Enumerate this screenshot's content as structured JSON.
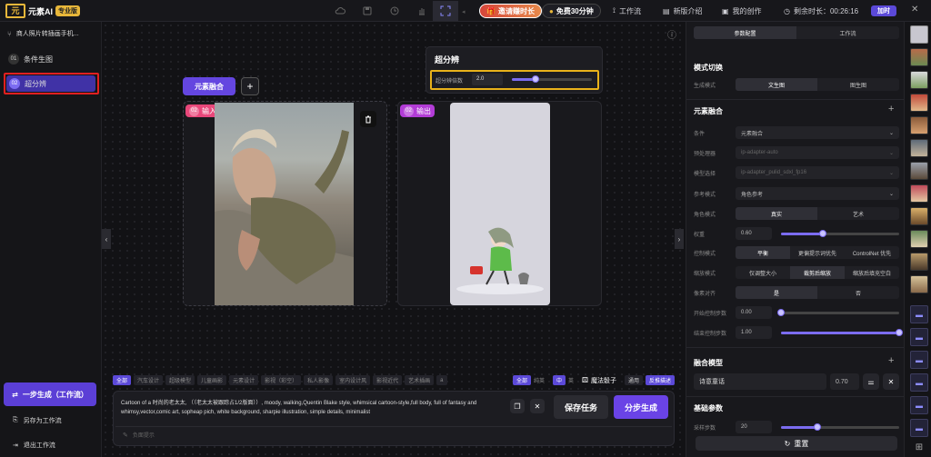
{
  "topbar": {
    "logo_text": "元素AI",
    "pro_badge": "专业版",
    "invite_label": "邀请赚时长",
    "free_label": "免费30分钟",
    "workflow_label": "工作流",
    "new_intro_label": "新版介绍",
    "my_works_label": "我的创作",
    "time_left_label": "剩余时长：00:26:16",
    "renew_label": "加时"
  },
  "left": {
    "project_title": "商人照片转插画手机...",
    "steps": [
      {
        "num": "01",
        "label": "条件生图"
      },
      {
        "num": "02",
        "label": "超分辨"
      }
    ],
    "one_step_label": "一步生成（工作流）",
    "save_workflow_label": "另存为工作流",
    "exit_workflow_label": "退出工作流"
  },
  "canvas": {
    "node_title": "元素融合",
    "input_tag": {
      "num": "02",
      "label": "输入"
    },
    "output_tag": {
      "num": "02",
      "label": "输出"
    }
  },
  "superres": {
    "title": "超分辨",
    "factor_label": "超分辨倍数",
    "factor_value": "2.0",
    "factor_fraction": 0.3
  },
  "prompt": {
    "filters": [
      "全部",
      "汽车设计",
      "超级模型",
      "儿童画影",
      "元素设计",
      "影视（彩空）",
      "私人影像",
      "室内设计风",
      "影视近代",
      "艺术插画",
      "a"
    ],
    "lang_all": "全部",
    "lang_short": "纯英",
    "lang_cn": "中",
    "lang_en": "英",
    "magic_label": "魔法骰子",
    "use_label": "通用",
    "reverse_label": "反推描述",
    "text": "Cartoon of a 时尚的老太太, （（老太太被跟踪占1/2版面））, moody, walking,Quentin Blake style, whimsical cartoon-style,full body, full of fantasy and whimsy,vector,comic art, sopheap pich, white background, sharpie illustration, simple details, minimalist",
    "negative_placeholder": "负面提示",
    "save_task_label": "保存任务",
    "generate_label": "分步生成"
  },
  "right": {
    "tabs": [
      "参数配置",
      "工作流"
    ],
    "mode_section": "模式切换",
    "gen_mode_label": "生成模式",
    "gen_mode_options": [
      "文生图",
      "图生图"
    ],
    "fusion_section": "元素融合",
    "rows": {
      "condition": {
        "label": "条件",
        "value": "元素融合"
      },
      "preprocess": {
        "label": "预处理器",
        "value": "ip-adapter-auto"
      },
      "model": {
        "label": "模型选择",
        "value": "ip-adapter_pulid_sdxl_fp16"
      },
      "ref_mode": {
        "label": "参考模式",
        "value": "角色参考"
      },
      "role_mode": {
        "label": "角色模式",
        "options": [
          "真实",
          "艺术"
        ]
      },
      "weight": {
        "label": "权重",
        "value": "0.60",
        "fraction": 0.35
      },
      "control_mode": {
        "label": "控制模式",
        "options": [
          "平衡",
          "更偏提示词优先",
          "ControlNet 优先"
        ]
      },
      "resize": {
        "label": "缩放模式",
        "options": [
          "仅调整大小",
          "裁剪后缩放",
          "缩放后填充空白"
        ]
      },
      "pixel_perfect": {
        "label": "像素对齐",
        "options": [
          "是",
          "否"
        ]
      },
      "start_step": {
        "label": "开始控制步数",
        "value": "0.00",
        "fraction": 0.0
      },
      "end_step": {
        "label": "结束控制步数",
        "value": "1.00",
        "fraction": 1.0
      }
    },
    "lora_section": "融合模型",
    "lora_name": "诗意童话",
    "lora_weight": "0.70",
    "base_section": "基础参数",
    "base_label": "采样步数",
    "base_value": "20",
    "reset_label": "重置"
  }
}
